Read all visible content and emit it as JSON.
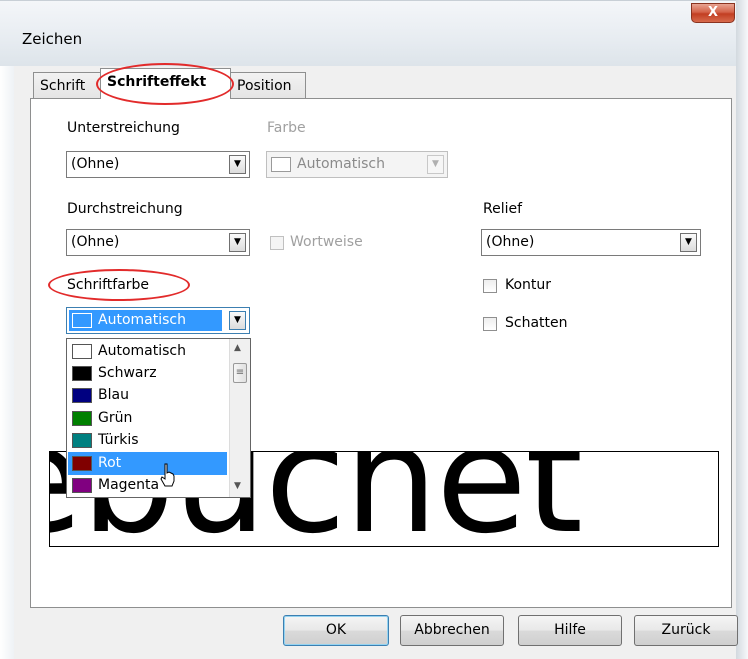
{
  "window": {
    "title": "Zeichen",
    "close_label": "X"
  },
  "tabs": [
    {
      "label": "Schrift"
    },
    {
      "label": "Schrifteffekt"
    },
    {
      "label": "Position"
    }
  ],
  "underline": {
    "label": "Unterstreichung",
    "value": "(Ohne)"
  },
  "color": {
    "label": "Farbe",
    "value": "Automatisch"
  },
  "strikethrough": {
    "label": "Durchstreichung",
    "value": "(Ohne)"
  },
  "word_by_word": {
    "label": "Wortweise",
    "checked": false
  },
  "relief": {
    "label": "Relief",
    "value": "(Ohne)"
  },
  "outline": {
    "label": "Kontur",
    "checked": false
  },
  "shadow": {
    "label": "Schatten",
    "checked": false
  },
  "font_color": {
    "label": "Schriftfarbe",
    "value": "Automatisch",
    "options": [
      {
        "label": "Automatisch",
        "color": "#ffffff"
      },
      {
        "label": "Schwarz",
        "color": "#000000"
      },
      {
        "label": "Blau",
        "color": "#000080"
      },
      {
        "label": "Grün",
        "color": "#008000"
      },
      {
        "label": "Türkis",
        "color": "#008080"
      },
      {
        "label": "Rot",
        "color": "#800000"
      },
      {
        "label": "Magenta",
        "color": "#800080"
      }
    ],
    "highlighted": "Rot"
  },
  "preview": {
    "text": "ebuchet"
  },
  "buttons": {
    "ok": "OK",
    "cancel": "Abbrechen",
    "help": "Hilfe",
    "reset": "Zurück"
  },
  "accent": {
    "highlight_oval": "#e22b2b",
    "selection": "#3399ff"
  }
}
